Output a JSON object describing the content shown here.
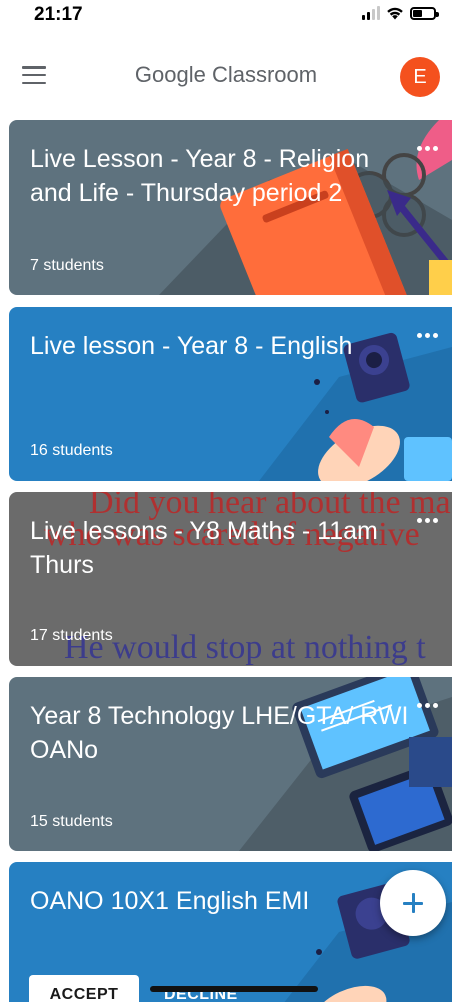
{
  "status_bar": {
    "time": "21:17"
  },
  "app_bar": {
    "title": "Google Classroom",
    "avatar_initial": "E"
  },
  "classes": [
    {
      "title": "Live  Lesson - Year 8  - Religion and Life - Thursday period  2",
      "students": "7 students",
      "theme_color": "#5e727e"
    },
    {
      "title": "Live lesson - Year 8 - English",
      "students": "16 students",
      "theme_color": "#2680c2"
    },
    {
      "title": "Live lessons - Y8 Maths - 11am Thurs",
      "students": "17 students",
      "theme_color": "#6b6b6b",
      "banner_text": [
        "Did you hear about the ma",
        "who was scared of negative",
        "He would stop at nothing t"
      ]
    },
    {
      "title": "Year 8 Technology LHE/GTA/ RWI OANo",
      "students": "15 students",
      "theme_color": "#5e727e"
    },
    {
      "title": "OANO 10X1 English EMI",
      "theme_color": "#2680c2"
    }
  ],
  "invitation": {
    "accept_label": "ACCEPT",
    "decline_label": "DECLINE"
  },
  "icons": {
    "menu": "hamburger-menu-icon",
    "more": "more-horizontal-icon",
    "add": "plus-icon"
  }
}
